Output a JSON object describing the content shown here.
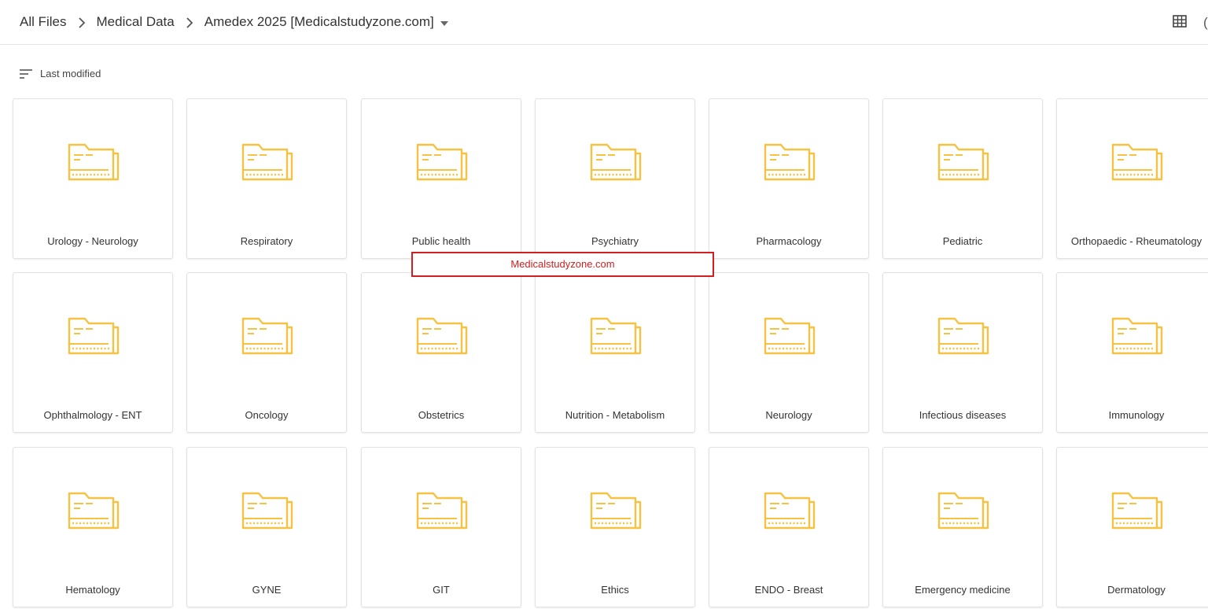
{
  "breadcrumb": {
    "items": [
      "All Files",
      "Medical Data",
      "Amedex 2025 [Medicalstudyzone.com]"
    ]
  },
  "sort": {
    "label": "Last modified"
  },
  "watermark": {
    "text": "Medicalstudyzone.com"
  },
  "colors": {
    "folder": "#f5c242",
    "watermark": "#d11f1f"
  },
  "folders": [
    "Urology - Neurology",
    "Respiratory",
    "Public health",
    "Psychiatry",
    "Pharmacology",
    "Pediatric",
    "Orthopaedic - Rheumatology",
    "Ophthalmology - ENT",
    "Oncology",
    "Obstetrics",
    "Nutrition - Metabolism",
    "Neurology",
    "Infectious diseases",
    "Immunology",
    "Hematology",
    "GYNE",
    "GIT",
    "Ethics",
    "ENDO - Breast",
    "Emergency medicine",
    "Dermatology"
  ]
}
